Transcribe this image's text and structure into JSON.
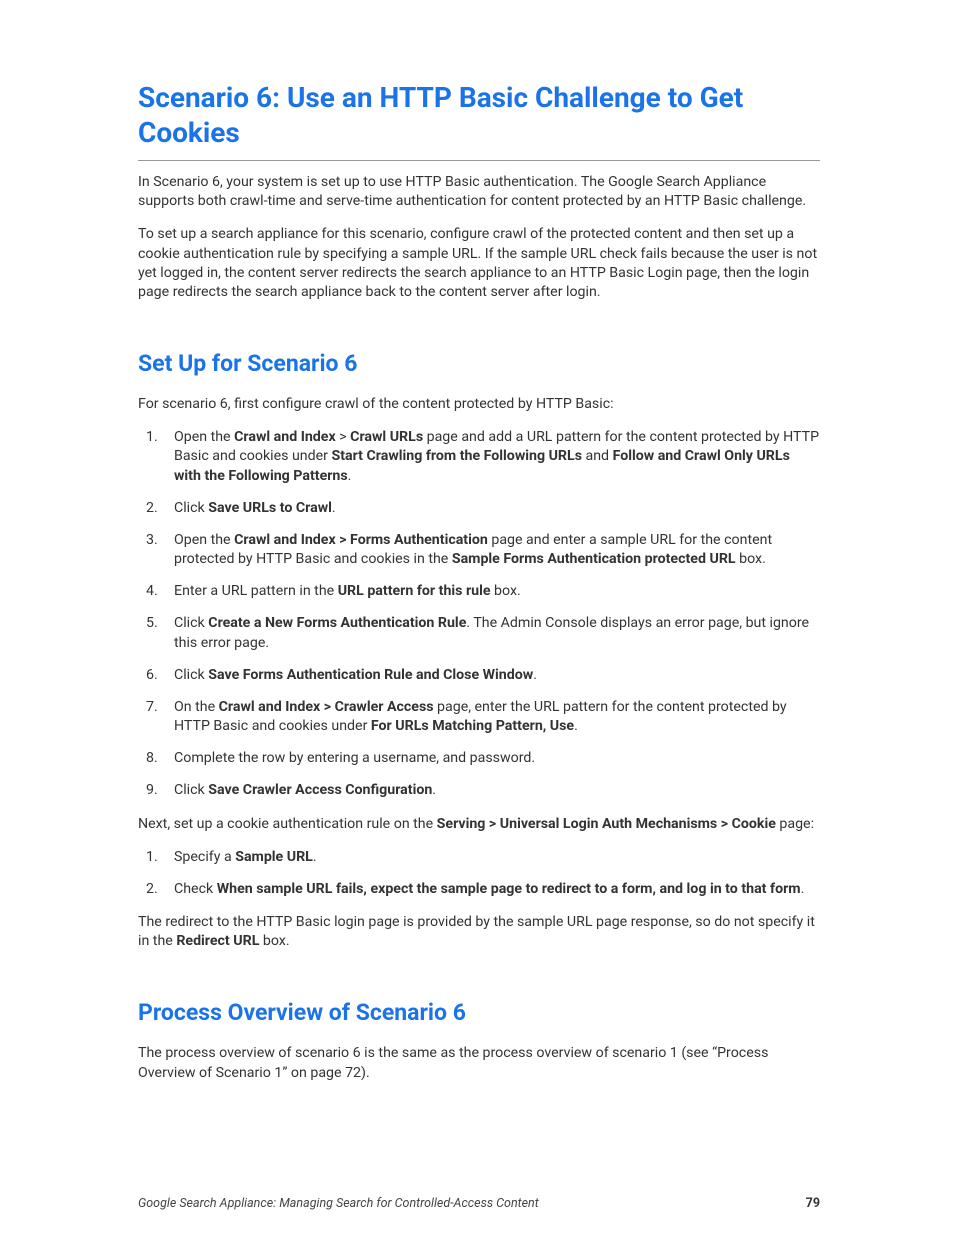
{
  "heading1": "Scenario 6: Use an HTTP Basic Challenge to Get Cookies",
  "para1": "In Scenario 6, your system is set up to use HTTP Basic authentication. The Google Search Appliance supports both crawl-time and serve-time authentication for content protected by an HTTP Basic challenge.",
  "para2": "To set up a search appliance for this scenario, configure crawl of the protected content and then set up a cookie authentication rule by specifying a sample URL. If the sample URL check fails because the user is not yet logged in, the content server redirects the search appliance to an HTTP Basic Login page, then the login page redirects the search appliance back to the content server after login.",
  "heading2a": "Set Up for Scenario 6",
  "para3": "For scenario 6, first configure crawl of the content protected by HTTP Basic:",
  "li1_a": "Open the ",
  "li1_b1": "Crawl and Index",
  "li1_gt": " > ",
  "li1_b2": "Crawl URLs",
  "li1_c": " page and add a URL pattern for the content protected by HTTP Basic and cookies under ",
  "li1_b3": "Start Crawling from the Following URLs",
  "li1_and": " and ",
  "li1_b4": "Follow and Crawl Only URLs with the Following Patterns",
  "li1_d": ".",
  "li2_a": "Click ",
  "li2_b": "Save URLs to Crawl",
  "li2_c": ".",
  "li3_a": "Open the ",
  "li3_b1": "Crawl and Index > Forms Authentication",
  "li3_c": " page and enter a sample URL for the content protected by HTTP Basic and cookies in the ",
  "li3_b2": "Sample Forms Authentication protected URL",
  "li3_d": " box.",
  "li4_a": "Enter a URL pattern in the ",
  "li4_b": "URL pattern for this rule",
  "li4_c": " box.",
  "li5_a": "Click ",
  "li5_b": "Create a New Forms Authentication Rule",
  "li5_c": ". The Admin Console displays an error page, but ignore this error page.",
  "li6_a": "Click ",
  "li6_b": "Save Forms Authentication Rule and Close Window",
  "li6_c": ".",
  "li7_a": "On the ",
  "li7_b1": "Crawl and Index > Crawler Access",
  "li7_c": " page, enter the URL pattern for the content protected by HTTP Basic and cookies under ",
  "li7_b2": "For URLs Matching Pattern, Use",
  "li7_d": ".",
  "li8": "Complete the row by entering a username, and password.",
  "li9_a": "Click ",
  "li9_b": "Save Crawler Access Configuration",
  "li9_c": ".",
  "para4_a": "Next, set up a cookie authentication rule on the ",
  "para4_b": "Serving > Universal Login Auth Mechanisms > Cookie",
  "para4_c": " page:",
  "li2_1_a": "Specify a ",
  "li2_1_b": "Sample URL",
  "li2_1_c": ".",
  "li2_2_a": "Check ",
  "li2_2_b": "When sample URL fails, expect the sample page to redirect to a form, and log in to that form",
  "li2_2_c": ".",
  "para5_a": "The redirect to the HTTP Basic login page is provided by the sample URL page response, so do not specify it in the ",
  "para5_b": "Redirect URL",
  "para5_c": " box.",
  "heading2b": "Process Overview of Scenario 6",
  "para6": "The process overview of scenario 6 is the same as the process overview of scenario 1 (see “Process Overview of Scenario 1” on page 72).",
  "footer_title": "Google Search Appliance: Managing Search for Controlled-Access Content",
  "footer_page": "79"
}
